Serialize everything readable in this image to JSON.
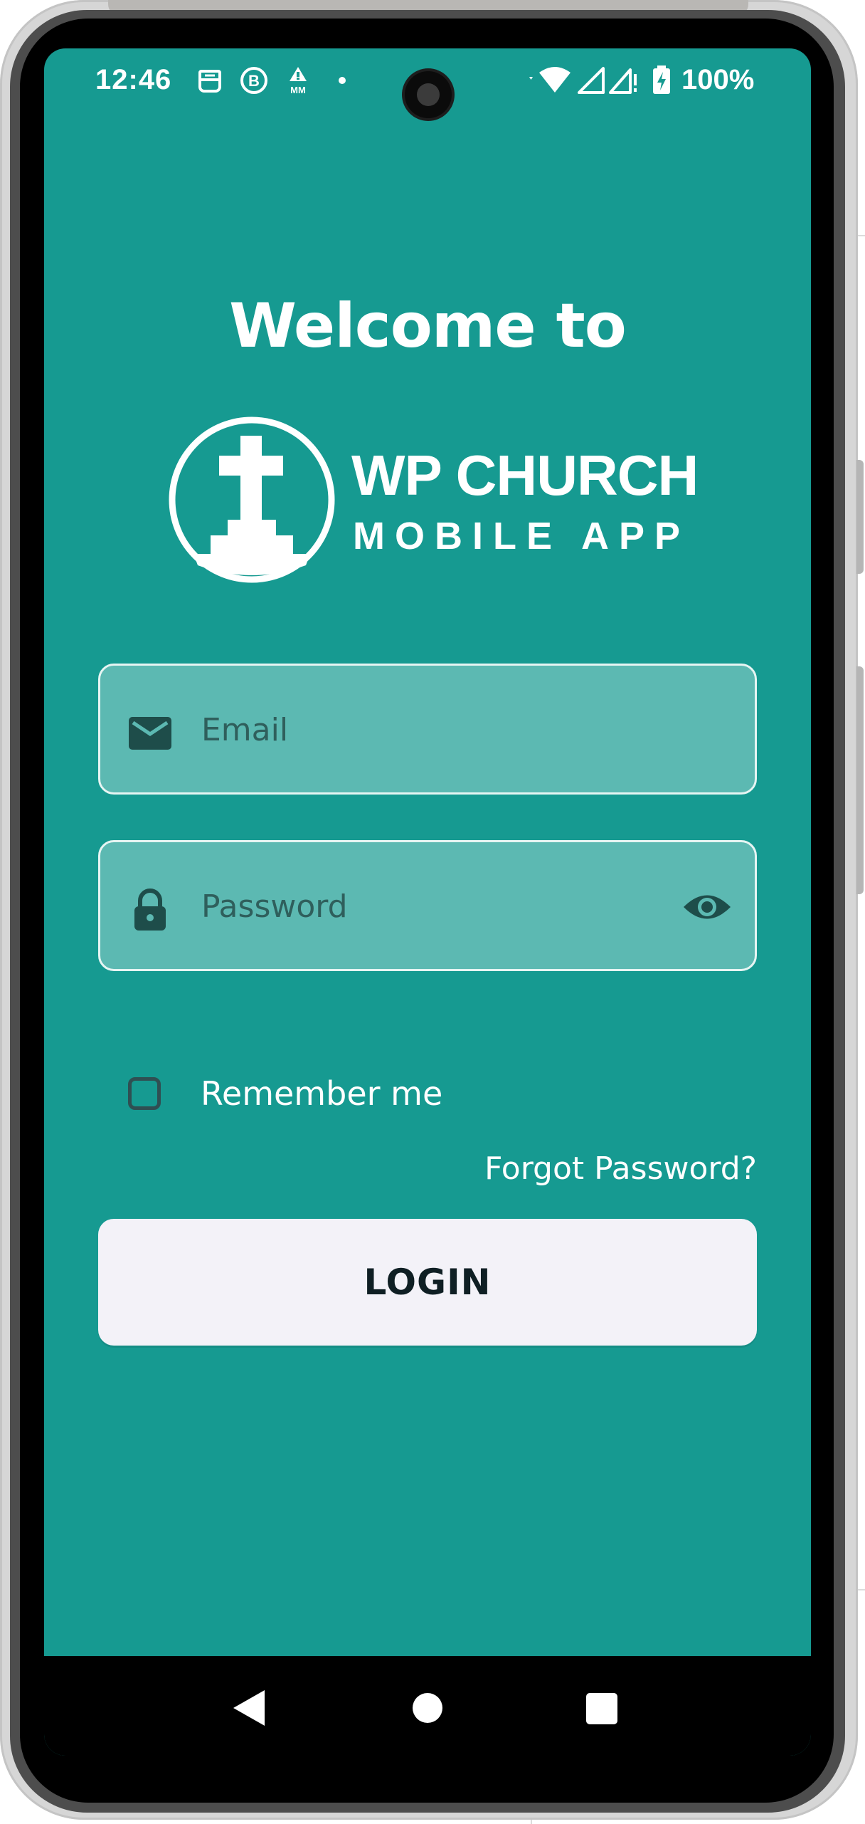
{
  "status_bar": {
    "time": "12:46",
    "battery_percent": "100%",
    "icons": [
      "notification-face-icon",
      "business-b-icon",
      "alert-mm-icon",
      "dot-icon",
      "wifi-icon",
      "signal-icon",
      "signal-alert-icon",
      "battery-charging-icon"
    ]
  },
  "login_screen": {
    "welcome_text": "Welcome to",
    "logo": {
      "title": "WP CHURCH",
      "subtitle": "MOBILE APP"
    },
    "email": {
      "placeholder": "Email",
      "value": ""
    },
    "password": {
      "placeholder": "Password",
      "value": ""
    },
    "remember_me": {
      "label": "Remember me",
      "checked": false
    },
    "forgot_password": "Forgot Password?",
    "login_button": "LOGIN"
  },
  "navigation_bar": {
    "buttons": [
      "back",
      "home",
      "recents"
    ]
  },
  "colors": {
    "background": "#169a91",
    "field_fill": "#5cb9b2",
    "field_icon": "#1e4d4a",
    "button_fill": "#f3f2f8",
    "button_text": "#0f1f24"
  }
}
